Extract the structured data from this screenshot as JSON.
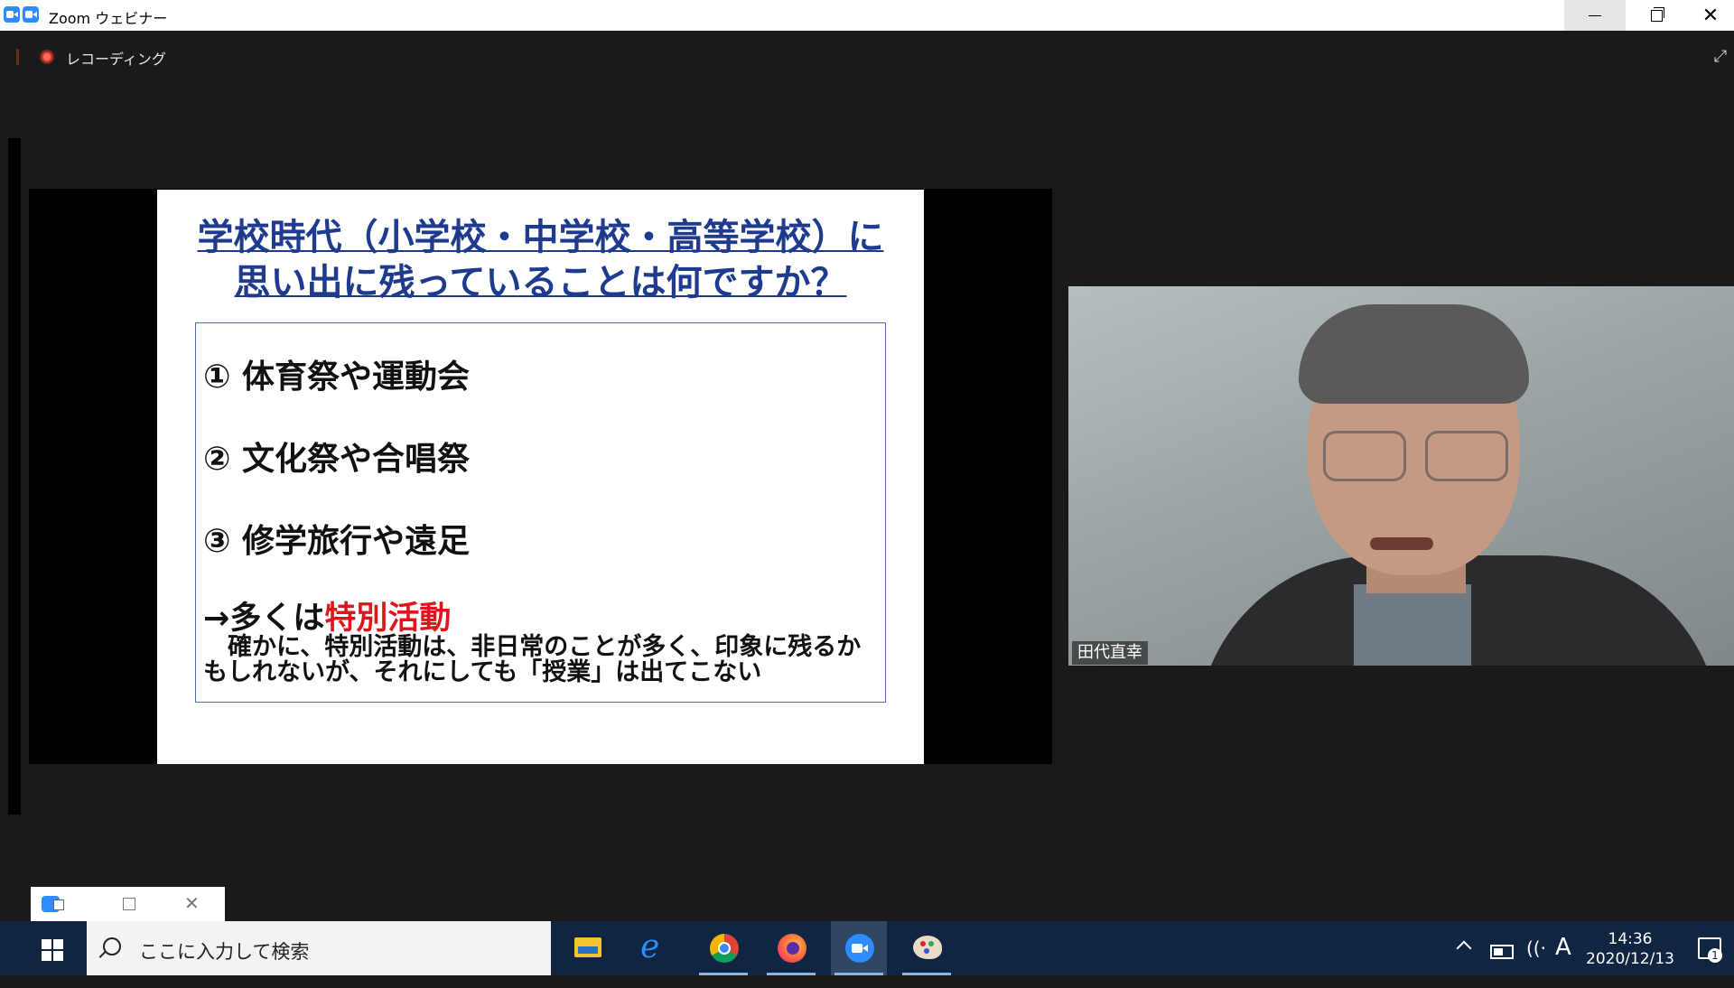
{
  "window": {
    "title": "Zoom ウェビナー",
    "minimize_icon": "minimize-icon",
    "maximize_icon": "restore-icon",
    "close_label": "✕"
  },
  "recording": {
    "label": "レコーディング",
    "color": "#d9382b"
  },
  "slide": {
    "title_line1": "学校時代（小学校・中学校・高等学校）に",
    "title_line2": "思い出に残っていることは何ですか？",
    "title_color": "#1f3b8f",
    "items": [
      "① 体育祭や運動会",
      "② 文化祭や合唱祭",
      "③ 修学旅行や遠足"
    ],
    "conclusion_prefix": "→多くは",
    "conclusion_highlight": "特別活動",
    "highlight_color": "#e0141c",
    "note": "　確かに、特別活動は、非日常のことが多く、印象に残るかもしれないが、それにしても「授業」は出てこない"
  },
  "participant": {
    "name": "田代直幸"
  },
  "mini_bar": {
    "close_label": "✕"
  },
  "taskbar": {
    "search_placeholder": "ここに入力して検索",
    "apps": [
      "file-explorer-icon",
      "internet-explorer-icon",
      "chrome-icon",
      "firefox-icon",
      "zoom-icon",
      "paint-icon"
    ],
    "ime_label": "A",
    "time": "14:36",
    "date": "2020/12/13",
    "notification_count": "1"
  }
}
